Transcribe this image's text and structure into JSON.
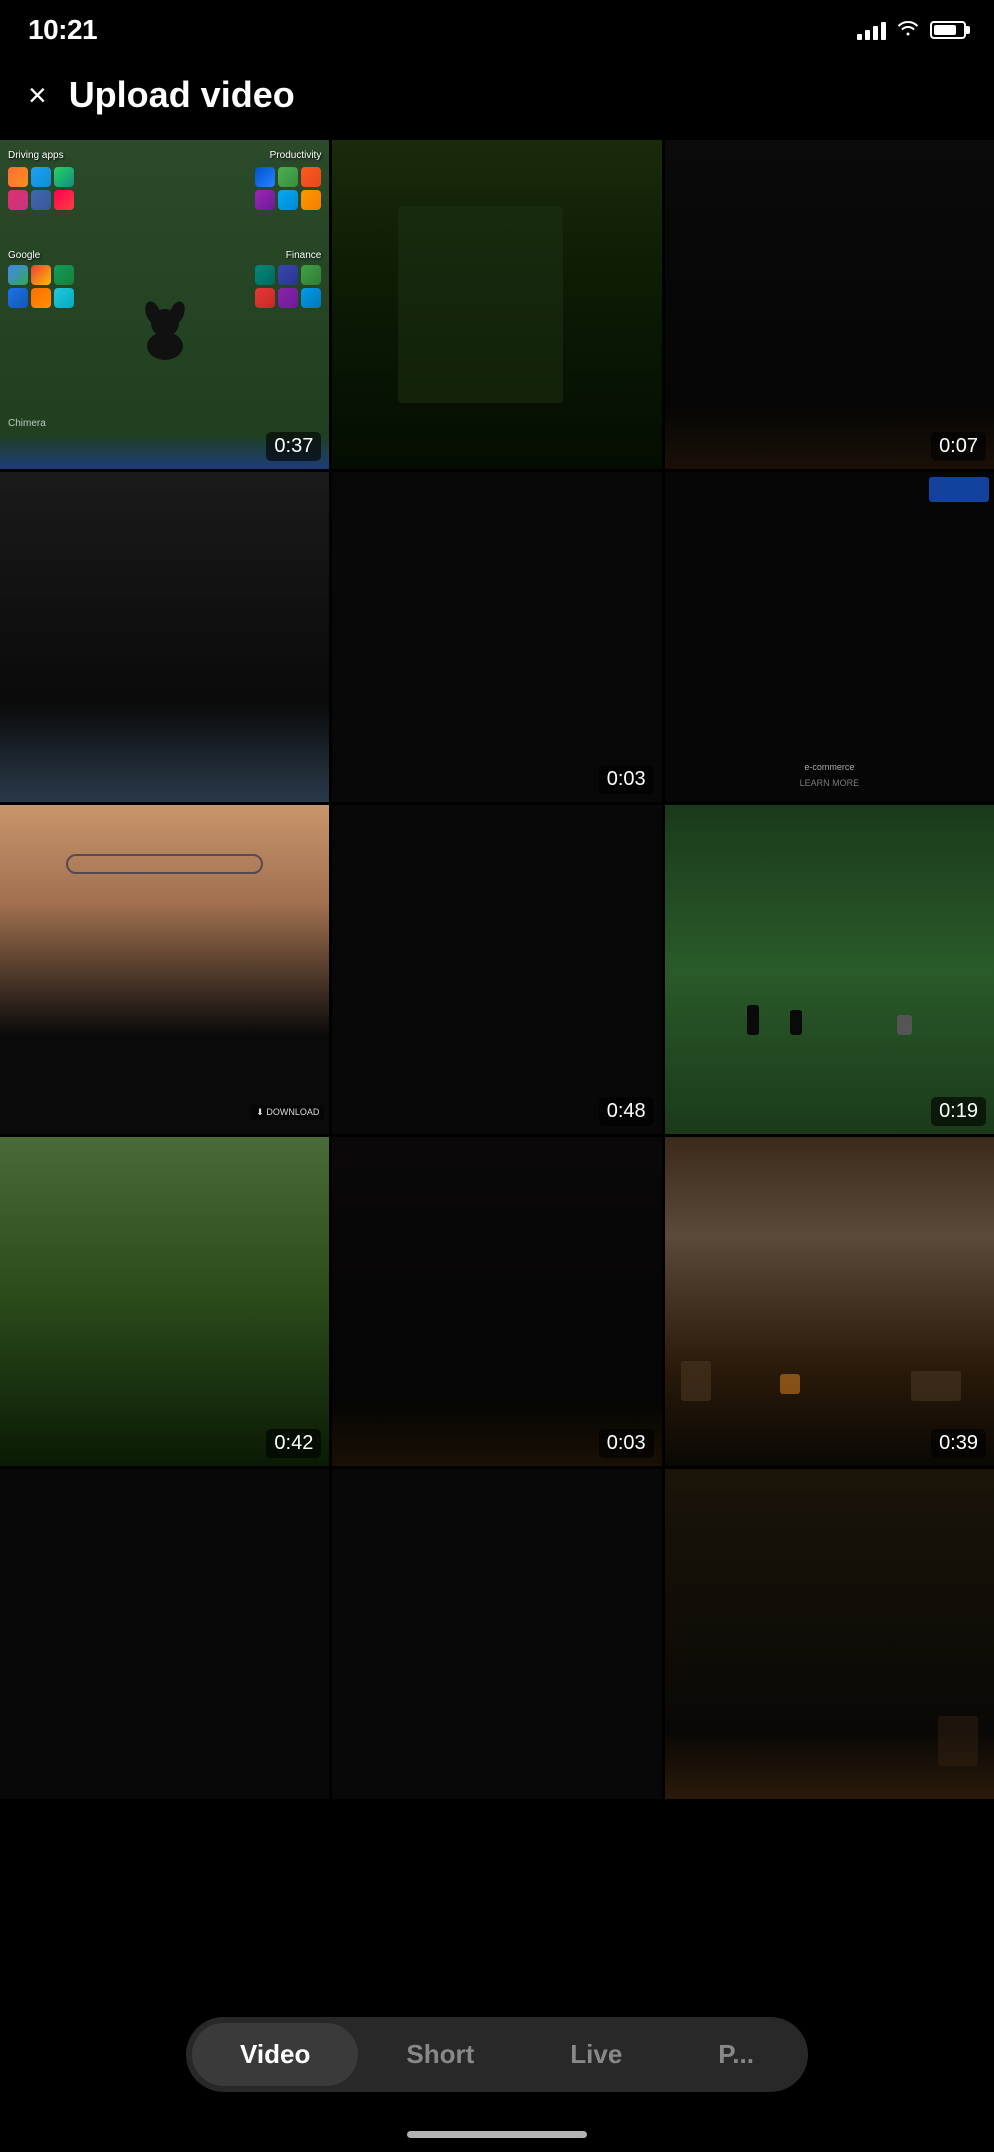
{
  "statusBar": {
    "time": "10:21",
    "signalBars": [
      6,
      10,
      14,
      18
    ],
    "battery": 80
  },
  "header": {
    "closeLabel": "×",
    "title": "Upload video"
  },
  "videos": [
    {
      "id": 1,
      "duration": "0:37",
      "selected": true,
      "type": "phone-screen"
    },
    {
      "id": 2,
      "duration": "",
      "selected": false,
      "type": "outdoor-dark"
    },
    {
      "id": 3,
      "duration": "0:07",
      "selected": false,
      "type": "dark-interior"
    },
    {
      "id": 4,
      "duration": "",
      "selected": false,
      "type": "car-interior"
    },
    {
      "id": 5,
      "duration": "0:03",
      "selected": false,
      "type": "dark"
    },
    {
      "id": 6,
      "duration": "",
      "selected": false,
      "type": "screen-record"
    },
    {
      "id": 7,
      "duration": "",
      "selected": false,
      "type": "face"
    },
    {
      "id": 8,
      "duration": "0:48",
      "selected": false,
      "type": "dark"
    },
    {
      "id": 9,
      "duration": "0:19",
      "selected": false,
      "type": "people-green"
    },
    {
      "id": 10,
      "duration": "0:42",
      "selected": false,
      "type": "outdoor"
    },
    {
      "id": 11,
      "duration": "0:03",
      "selected": false,
      "type": "dark"
    },
    {
      "id": 12,
      "duration": "0:39",
      "selected": false,
      "type": "living-room"
    },
    {
      "id": 13,
      "duration": "",
      "selected": false,
      "type": "dark"
    },
    {
      "id": 14,
      "duration": "",
      "selected": false,
      "type": "dark"
    },
    {
      "id": 15,
      "duration": "",
      "selected": false,
      "type": "room"
    }
  ],
  "tabs": [
    {
      "id": "video",
      "label": "Video",
      "active": true
    },
    {
      "id": "short",
      "label": "Short",
      "active": false
    },
    {
      "id": "live",
      "label": "Live",
      "active": false
    },
    {
      "id": "podcast",
      "label": "P...",
      "active": false
    }
  ]
}
